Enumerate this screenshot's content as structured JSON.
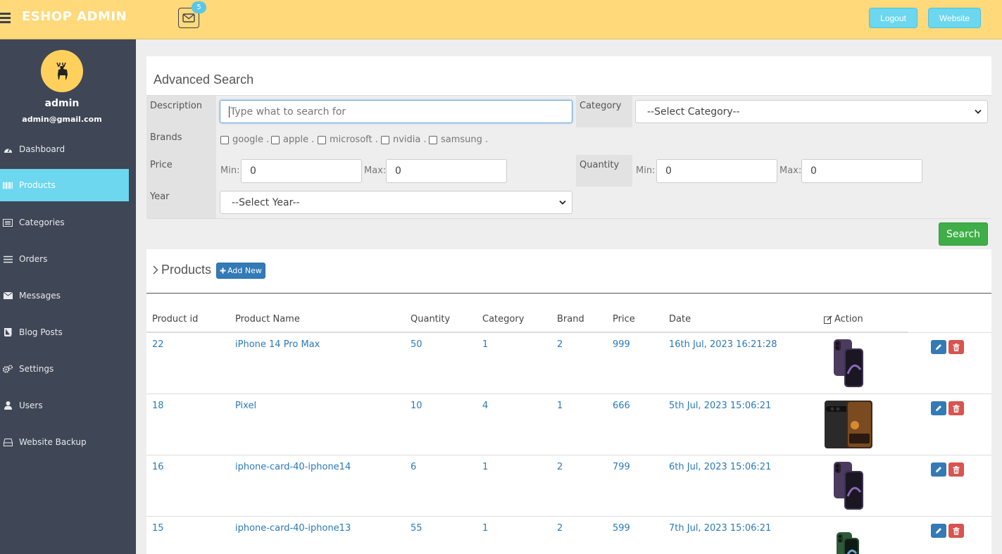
{
  "header": {
    "brand": "ESHOP ADMIN",
    "mail_count": "5",
    "logout_label": "Logout",
    "website_label": "Website"
  },
  "sidebar": {
    "user_name": "admin",
    "user_email": "admin@gmail.com",
    "items": [
      {
        "label": "Dashboard",
        "icon": "dashboard-icon"
      },
      {
        "label": "Products",
        "icon": "barcode-icon",
        "active": true
      },
      {
        "label": "Categories",
        "icon": "list-alt-icon"
      },
      {
        "label": "Orders",
        "icon": "list-icon"
      },
      {
        "label": "Messages",
        "icon": "envelope-icon"
      },
      {
        "label": "Blog Posts",
        "icon": "book-icon"
      },
      {
        "label": "Settings",
        "icon": "cogs-icon"
      },
      {
        "label": "Users",
        "icon": "user-icon"
      },
      {
        "label": "Website Backup",
        "icon": "hdd-icon"
      }
    ]
  },
  "search": {
    "title": "Advanced Search",
    "description_label": "Description",
    "description_placeholder": "Type what to search for",
    "category_label": "Category",
    "category_value": "--Select Category--",
    "brands_label": "Brands",
    "brands": [
      "google .",
      "apple .",
      "microsoft .",
      "nvidia .",
      "samsung ."
    ],
    "price_label": "Price",
    "quantity_label": "Quantity",
    "min_label": "Min:",
    "max_label": "Max:",
    "price_min": "0",
    "price_max": "0",
    "qty_min": "0",
    "qty_max": "0",
    "year_label": "Year",
    "year_value": "--Select Year--",
    "search_button": "Search"
  },
  "products": {
    "title": "Products",
    "add_new": "Add New",
    "columns": [
      "Product id",
      "Product Name",
      "Quantity",
      "Category",
      "Brand",
      "Price",
      "Date",
      "Action"
    ],
    "rows": [
      {
        "id": "22",
        "name": "iPhone 14 Pro Max",
        "quantity": "50",
        "category": "1",
        "brand": "2",
        "price": "999",
        "date": "16th Jul, 2023 16:21:28",
        "image": "iphone-purple"
      },
      {
        "id": "18",
        "name": "Pixel",
        "quantity": "10",
        "category": "4",
        "brand": "1",
        "price": "666",
        "date": "5th Jul, 2023 15:06:21",
        "image": "pixel-black"
      },
      {
        "id": "16",
        "name": "iphone-card-40-iphone14",
        "quantity": "6",
        "category": "1",
        "brand": "2",
        "price": "799",
        "date": "6th Jul, 2023 15:06:21",
        "image": "iphone-purple"
      },
      {
        "id": "15",
        "name": "iphone-card-40-iphone13",
        "quantity": "55",
        "category": "1",
        "brand": "2",
        "price": "599",
        "date": "7th Jul, 2023 15:06:21",
        "image": "iphone-green"
      }
    ]
  },
  "colors": {
    "topbar": "#ffd97a",
    "sidebar": "#3f4656",
    "active": "#6cd7ee",
    "link": "#2a7ab8",
    "success": "#3fae49",
    "primary": "#337ab7",
    "danger": "#d9534f"
  }
}
